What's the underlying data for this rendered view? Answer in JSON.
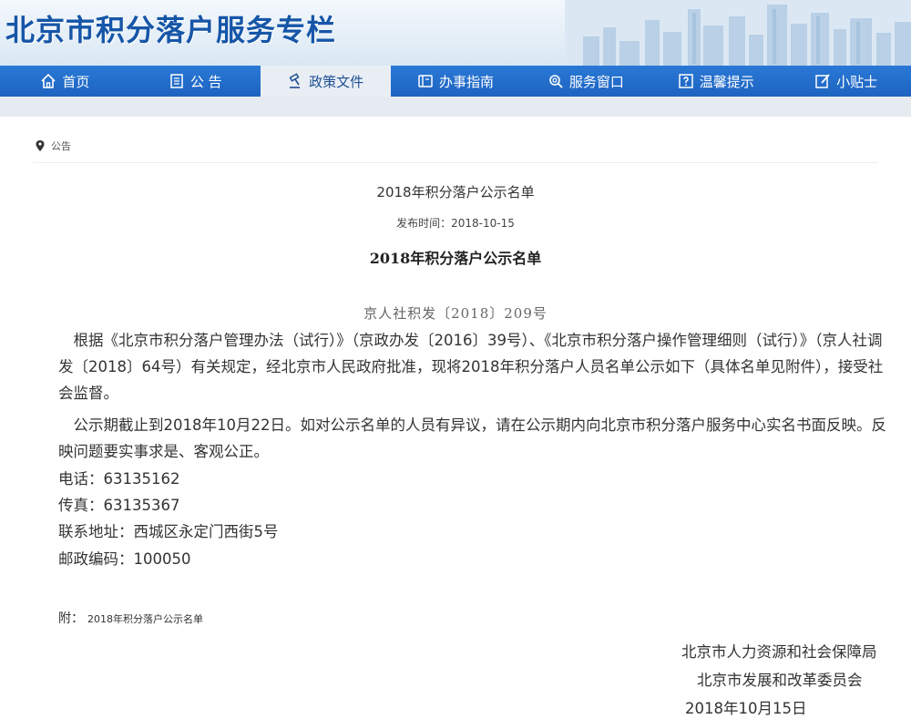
{
  "header": {
    "title": "北京市积分落户服务专栏"
  },
  "nav": [
    {
      "label": "首页",
      "icon": "home-icon"
    },
    {
      "label": "公 告",
      "icon": "notice-icon"
    },
    {
      "label": "政策文件",
      "icon": "gavel-icon",
      "active": true
    },
    {
      "label": "办事指南",
      "icon": "book-icon"
    },
    {
      "label": "服务窗口",
      "icon": "search-icon"
    },
    {
      "label": "温馨提示",
      "icon": "question-icon"
    },
    {
      "label": "小贴士",
      "icon": "edit-icon"
    }
  ],
  "breadcrumb": {
    "label": "公告",
    "icon": "location-pin-icon"
  },
  "article": {
    "title": "2018年积分落户公示名单",
    "pubdate": "发布时间：2018-10-15",
    "heading": "2018年积分落户公示名单",
    "doc_number": "京人社积发〔2018〕209号",
    "para1": "　根据《北京市积分落户管理办法（试行）》（京政办发〔2016〕39号）、《北京市积分落户操作管理细则（试行）》（京人社调发〔2018〕64号）有关规定，经北京市人民政府批准，现将2018年积分落户人员名单公示如下（具体名单见附件），接受社会监督。",
    "para2": "　公示期截止到2018年10月22日。如对公示名单的人员有异议，请在公示期内向北京市积分落户服务中心实名书面反映。反映问题要实事求是、客观公正。",
    "phone": "电话：63135162",
    "fax": "传真：63135367",
    "address": "联系地址：西城区永定门西街5号",
    "postcode": "邮政编码：100050",
    "attachment_prefix": "附：",
    "attachment_name": "2018年积分落户公示名单",
    "signature_1": "北京市人力资源和社会保障局",
    "signature_2": "北京市发展和改革委员会",
    "signature_date": "2018年10月15日"
  },
  "colors": {
    "nav_bg": "#1d64c0",
    "nav_active_bg": "#e9eef5",
    "title_blue": "#1656a8"
  }
}
